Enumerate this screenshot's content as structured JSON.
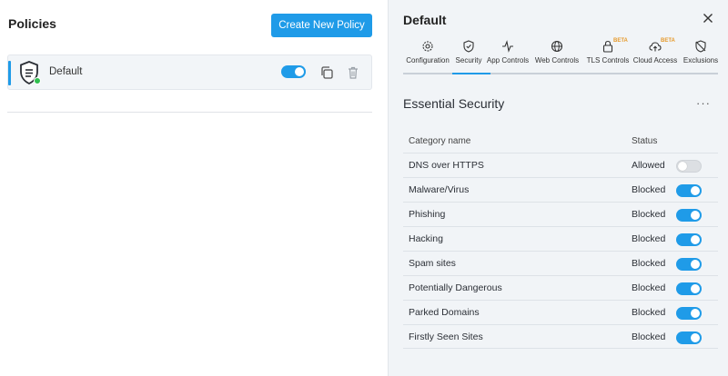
{
  "left": {
    "title": "Policies",
    "create_button": "Create New Policy",
    "policy": {
      "name": "Default",
      "enabled": true
    }
  },
  "right": {
    "title": "Default",
    "tabs": [
      {
        "label": "Configuration",
        "icon": "gear-icon"
      },
      {
        "label": "Security",
        "icon": "shield-icon",
        "active": true
      },
      {
        "label": "App Controls",
        "icon": "pulse-icon"
      },
      {
        "label": "Web Controls",
        "icon": "globe-icon"
      },
      {
        "label": "TLS Controls",
        "icon": "lock-icon",
        "badge": "BETA"
      },
      {
        "label": "Cloud Access",
        "icon": "cloud-upload-icon",
        "badge": "BETA"
      },
      {
        "label": "Exclusions",
        "icon": "shield-off-icon"
      }
    ],
    "section_title": "Essential Security",
    "more": "···",
    "table": {
      "header_category": "Category name",
      "header_status": "Status",
      "rows": [
        {
          "category": "DNS over HTTPS",
          "status": "Allowed",
          "enabled": false
        },
        {
          "category": "Malware/Virus",
          "status": "Blocked",
          "enabled": true
        },
        {
          "category": "Phishing",
          "status": "Blocked",
          "enabled": true
        },
        {
          "category": "Hacking",
          "status": "Blocked",
          "enabled": true
        },
        {
          "category": "Spam sites",
          "status": "Blocked",
          "enabled": true
        },
        {
          "category": "Potentially Dangerous",
          "status": "Blocked",
          "enabled": true
        },
        {
          "category": "Parked Domains",
          "status": "Blocked",
          "enabled": true
        },
        {
          "category": "Firstly Seen Sites",
          "status": "Blocked",
          "enabled": true
        }
      ]
    }
  },
  "colors": {
    "accent": "#1f9be8",
    "online": "#2fbf4f",
    "beta": "#e69a2c"
  }
}
